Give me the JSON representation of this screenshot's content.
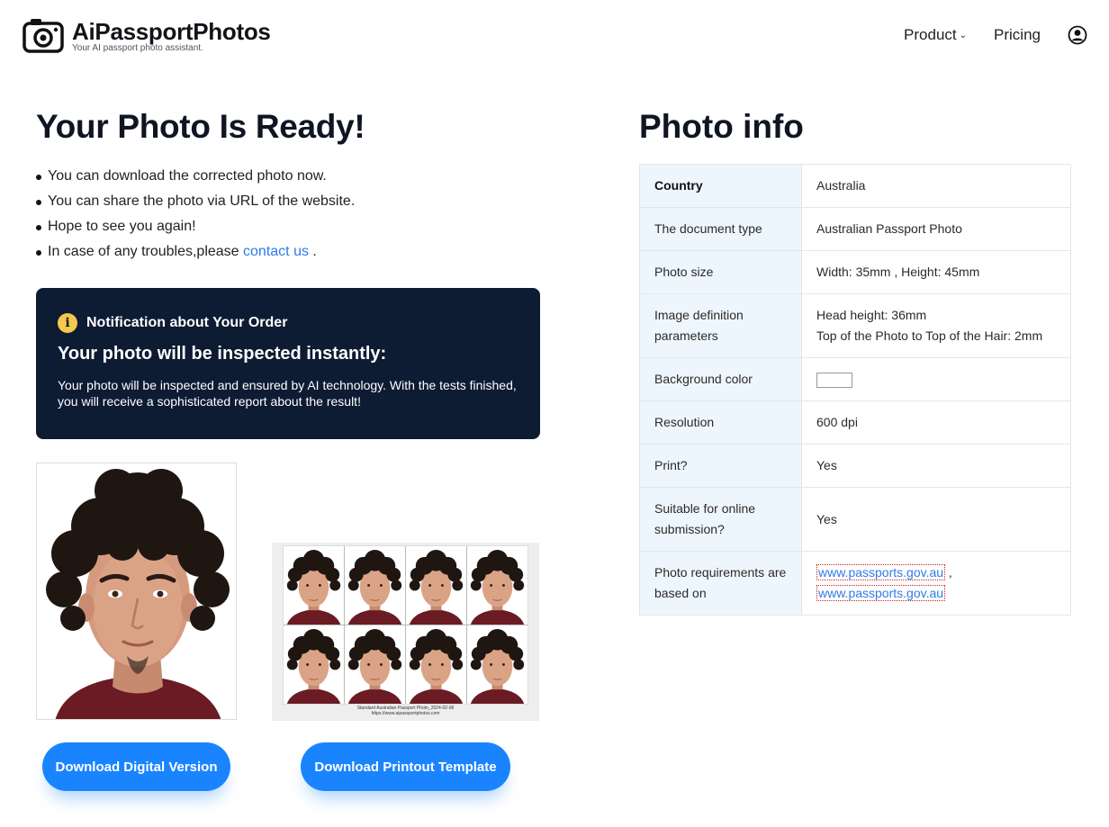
{
  "brand": {
    "name": "AiPassportPhotos",
    "tagline": "Your AI passport photo assistant."
  },
  "nav": {
    "product": "Product",
    "pricing": "Pricing"
  },
  "left": {
    "title": "Your Photo Is Ready!",
    "bullets": [
      "You can download the corrected photo now.",
      "You can share the photo via URL of the website.",
      "Hope to see you again!",
      "In case of any troubles,please "
    ],
    "contact_link": "contact us",
    "contact_after": " ."
  },
  "notice": {
    "label": "Notification about Your Order",
    "title": "Your photo will be inspected instantly:",
    "body": "Your photo will be inspected and ensured by AI technology. With the tests finished, you will receive a sophisticated report about the result!"
  },
  "sheet": {
    "caption_line1": "Standard Australian Passport Photo_2024-02-06",
    "caption_line2": "https://www.aipassportphotos.com"
  },
  "buttons": {
    "digital": "Download Digital Version",
    "print": "Download Printout Template"
  },
  "info": {
    "title": "Photo info",
    "rows": [
      {
        "key": "Country",
        "value": "Australia"
      },
      {
        "key": "The document type",
        "value": "Australian Passport Photo"
      },
      {
        "key": "Photo size",
        "value": "Width: 35mm , Height: 45mm"
      },
      {
        "key": "Image definition parameters",
        "value1": "Head height: 36mm",
        "value2": "Top of the Photo to Top of the Hair: 2mm"
      },
      {
        "key": "Background color",
        "color": "#ffffff"
      },
      {
        "key": "Resolution",
        "value": "600 dpi"
      },
      {
        "key": "Print?",
        "value": "Yes"
      },
      {
        "key": "Suitable for online submission?",
        "value": "Yes"
      },
      {
        "key": "Photo requirements are based on",
        "link1": "www.passports.gov.au",
        "sep": " ,",
        "link2": "www.passports.gov.au"
      }
    ]
  },
  "colors": {
    "accent": "#1a84ff",
    "notice_bg": "#0d1b33",
    "link": "#2f7be8",
    "key_bg": "#eef6fd"
  },
  "icons": [
    "camera-logo-icon",
    "chevron-down-icon",
    "user-account-icon",
    "info-icon"
  ]
}
